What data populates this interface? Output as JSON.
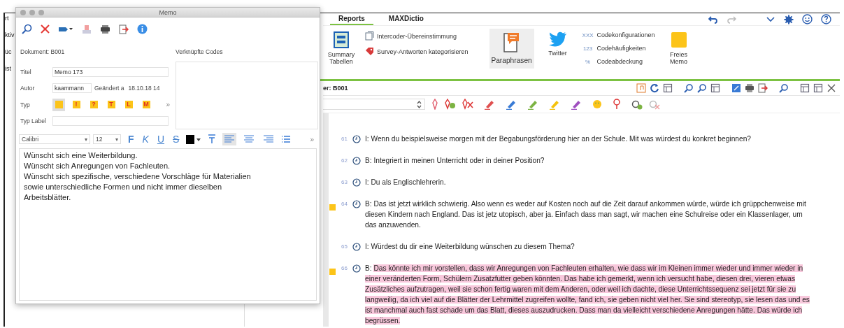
{
  "background_app": {
    "left_fragments": [
      "rt",
      "ktiv",
      "üc",
      "ist"
    ],
    "tabs": [
      {
        "label": "Reports",
        "selected": true
      },
      {
        "label": "MAXDictio",
        "selected": false
      }
    ],
    "ribbon": {
      "summary": "Summary Tabellen",
      "intercoder": "Intercoder-Übereinstimmung",
      "survey": "Survey-Antworten kategorisieren",
      "paraphrasen": "Paraphrasen",
      "twitter": "Twitter",
      "codekonfig": "Codekonfigurationen",
      "codehaeuf": "Codehäufigkeiten",
      "codeabdeck": "Codeabdeckung",
      "memo": "Freies Memo",
      "codehaeuf_icon": "123",
      "codekonfig_icon": "XXX",
      "codeabdeck_icon": "%"
    },
    "document_header": "er: B001"
  },
  "transcript": [
    {
      "number": "61",
      "speaker": "I:",
      "text": "Wenn du beispielsweise morgen mit der Begabungsförderung hier an der Schule. Mit was würdest du konkret beginnen?",
      "memo": false,
      "highlighted": false
    },
    {
      "number": "62",
      "speaker": "B:",
      "text": "Integriert in meinen Unterricht oder in deiner Position?",
      "memo": false,
      "highlighted": false
    },
    {
      "number": "63",
      "speaker": "I:",
      "text": "Du als Englischlehrerin.",
      "memo": false,
      "highlighted": false
    },
    {
      "number": "64",
      "speaker": "B:",
      "text": "Das ist jetzt wirklich schwierig. Also wenn es weder auf Kosten noch auf die Zeit darauf ankommen würde, würde ich grüppchenweise mit diesen Kindern nach England. Das ist jetz utopisch, aber ja. Einfach dass man sagt, wir machen eine Schulreise oder ein Klassenlager, um das anzuwenden.",
      "memo": true,
      "highlighted": false
    },
    {
      "number": "65",
      "speaker": "I:",
      "text": "Würdest du dir eine Weiterbildung wünschen zu diesem Thema?",
      "memo": false,
      "highlighted": false
    },
    {
      "number": "66",
      "speaker": "B:",
      "text": "Das könnte ich mir vorstellen, dass wir Anregungen von Fachleuten erhalten, wie dass wir im Kleinen immer wieder und immer wieder in einer veränderten Form, Schülern Zusatzfutter geben könnten. Das habe ich gemerkt, wenn ich versucht habe, diesen drei, vieren etwas Zusätzliches aufzutragen, weil sie schon fertig waren mit dem Anderen, oder weil ich dachte, diese Unterrichtssequenz sei jetzt für sie zu langweilig, da ich viel auf die Blätter der Lehrmittel zugreifen wollte, fand ich, sie geben nicht viel her. Sie sind stereotyp, sie lesen das und es ist manchmal auch fast schade um das Blatt, dieses auszudrucken. Dass man da vielleicht verschiedene Anregungen hätte. Das würde ich begrüssen.",
      "memo": true,
      "highlighted": true
    }
  ],
  "memo_window": {
    "title": "Memo",
    "document": "Dokument: B001",
    "linked_codes": "Verknüpfte Codes",
    "title_label": "Titel",
    "title_value": "Memo 173",
    "author_label": "Autor",
    "author_value": "kaammann",
    "changed_label": "Geändert a",
    "changed_value": "18.10.18 14",
    "type_label": "Typ",
    "dropdown_caret": "▾",
    "types": [
      {
        "selected": true
      },
      {
        "symbol": "!",
        "selected": false
      },
      {
        "symbol": "?",
        "selected": false
      },
      {
        "symbol": "T",
        "selected": false
      },
      {
        "symbol": "L",
        "selected": false
      },
      {
        "symbol": "M",
        "selected": false
      }
    ],
    "more": "»",
    "type_label_label": "Typ Label",
    "font": "Calibri",
    "size": "12",
    "bold": "F",
    "italic": "K",
    "underline": "U",
    "strike": "S",
    "align_left_selected": true,
    "lines": [
      "Wünscht sich eine Weiterbildung.",
      "Wünscht sich Anregungen von Fachleuten.",
      "Wünscht sich spezifische, verschiedene Vorschläge für Materialien",
      "sowie unterschiedliche Formen und nicht immer dieselben",
      "Arbeitsblätter."
    ]
  }
}
